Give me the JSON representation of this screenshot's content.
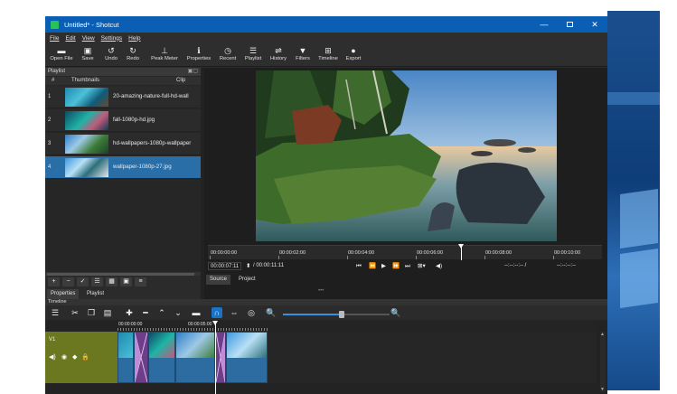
{
  "window": {
    "title": "Untitled* - Shotcut"
  },
  "menu": [
    "File",
    "Edit",
    "View",
    "Settings",
    "Help"
  ],
  "toolbar": [
    {
      "label": "Open File",
      "icon": "folder-icon",
      "glyph": "▬"
    },
    {
      "label": "Save",
      "icon": "save-icon",
      "glyph": "▣"
    },
    {
      "label": "Undo",
      "icon": "undo-icon",
      "glyph": "↺"
    },
    {
      "label": "Redo",
      "icon": "redo-icon",
      "glyph": "↻"
    },
    {
      "label": "Peak Meter",
      "icon": "meter-icon",
      "glyph": "⊥"
    },
    {
      "label": "Properties",
      "icon": "info-icon",
      "glyph": "ℹ"
    },
    {
      "label": "Recent",
      "icon": "clock-icon",
      "glyph": "◷"
    },
    {
      "label": "Playlist",
      "icon": "list-icon",
      "glyph": "☰"
    },
    {
      "label": "History",
      "icon": "history-icon",
      "glyph": "⇌"
    },
    {
      "label": "Filters",
      "icon": "filter-icon",
      "glyph": "▼"
    },
    {
      "label": "Timeline",
      "icon": "timeline-icon",
      "glyph": "⊞"
    },
    {
      "label": "Export",
      "icon": "export-icon",
      "glyph": "●"
    }
  ],
  "playlist": {
    "title": "Playlist",
    "header": {
      "num": "#",
      "thumbnails": "Thumbnails",
      "clip": "Clip"
    },
    "rows": [
      {
        "num": "1",
        "clip": "20-amazing-nature-full-hd-wall"
      },
      {
        "num": "2",
        "clip": "fall-1080p-hd.jpg"
      },
      {
        "num": "3",
        "clip": "hd-wallpapers-1080p-wallpaper"
      },
      {
        "num": "4",
        "clip": "wallpaper-1080p-27.jpg"
      }
    ],
    "selected_row": 4,
    "tabs": [
      "Properties",
      "Playlist"
    ]
  },
  "viewer": {
    "ruler": [
      "00:00:00:00",
      "00:00:02:00",
      "00:00:04:00",
      "00:00:06:00",
      "00:00:08:00",
      "00:00:10:00"
    ],
    "position": "00:00:07:11",
    "duration": "/ 00:00:11:11",
    "in_point": "--:--:--:-- /",
    "out_point": "--:--:--:--",
    "tabs": [
      "Source",
      "Project"
    ]
  },
  "timeline": {
    "title": "Timeline",
    "track_name": "V1",
    "ruler": [
      "00:00:00:00",
      "00:00:05:00"
    ],
    "zoom_level": 0.55
  }
}
